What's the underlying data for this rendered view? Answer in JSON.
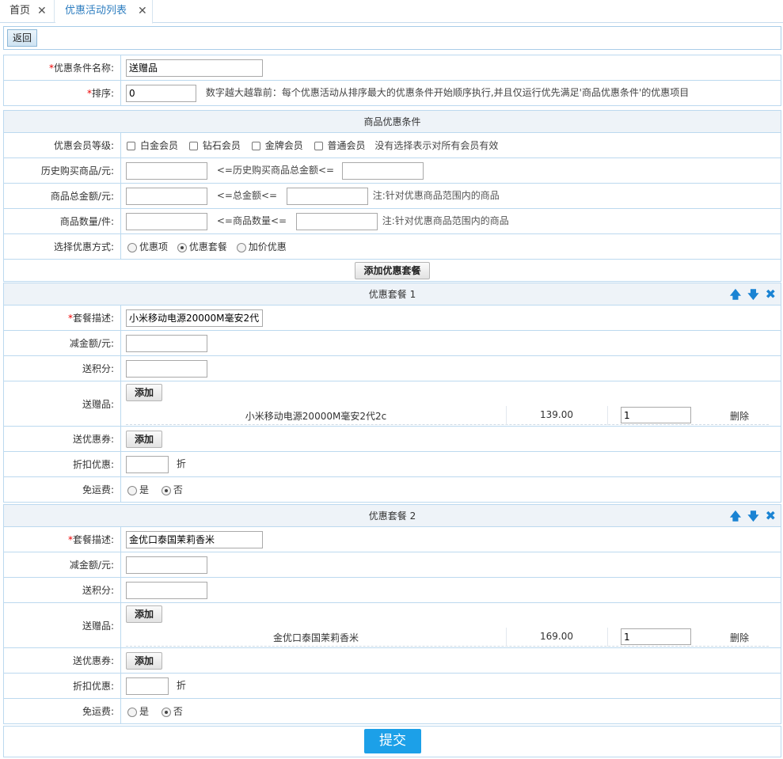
{
  "tabs": [
    {
      "label": "首页"
    },
    {
      "label": "优惠活动列表"
    }
  ],
  "toolbar": {
    "back_label": "返回"
  },
  "base": {
    "name_label": "优惠条件名称:",
    "name_value": "送赠品",
    "sort_label": "排序:",
    "sort_value": "0",
    "sort_hint": "数字越大越靠前：每个优惠活动从排序最大的优惠条件开始顺序执行,并且仅运行优先满足'商品优惠条件'的优惠项目"
  },
  "goods_condition": {
    "title": "商品优惠条件",
    "member_label": "优惠会员等级:",
    "members": [
      "白金会员",
      "钻石会员",
      "金牌会员",
      "普通会员"
    ],
    "member_hint": "没有选择表示对所有会员有效",
    "history_label": "历史购买商品/元:",
    "history_mid": "<=历史购买商品总金额<=",
    "total_label": "商品总金额/元:",
    "total_mid": "<=总金额<=",
    "total_hint": "注:针对优惠商品范围内的商品",
    "qty_label": "商品数量/件:",
    "qty_mid": "<=商品数量<=",
    "qty_hint": "注:针对优惠商品范围内的商品",
    "mode_label": "选择优惠方式:",
    "modes": [
      "优惠项",
      "优惠套餐",
      "加价优惠"
    ],
    "mode_selected": "优惠套餐",
    "add_package_label": "添加优惠套餐"
  },
  "packages": [
    {
      "title": "优惠套餐 1",
      "desc_label": "套餐描述:",
      "desc_value": "小米移动电源20000M毫安2代",
      "reduce_label": "减金额/元:",
      "points_label": "送积分:",
      "gift_label": "送赠品:",
      "add_label": "添加",
      "gift": {
        "name": "小米移动电源20000M毫安2代2c",
        "price": "139.00",
        "qty": "1",
        "delete": "删除"
      },
      "coupon_label": "送优惠券:",
      "discount_label": "折扣优惠:",
      "discount_unit": "折",
      "freeship_label": "免运费:",
      "yes": "是",
      "no": "否"
    },
    {
      "title": "优惠套餐 2",
      "desc_label": "套餐描述:",
      "desc_value": "金优口泰国茉莉香米",
      "reduce_label": "减金额/元:",
      "points_label": "送积分:",
      "gift_label": "送赠品:",
      "add_label": "添加",
      "gift": {
        "name": "金优口泰国茉莉香米",
        "price": "169.00",
        "qty": "1",
        "delete": "删除"
      },
      "coupon_label": "送优惠券:",
      "discount_label": "折扣优惠:",
      "discount_unit": "折",
      "freeship_label": "免运费:",
      "yes": "是",
      "no": "否"
    }
  ],
  "icons": {
    "up": "arrow-up-icon",
    "down": "arrow-down-icon",
    "remove": "close-icon"
  },
  "submit_label": "提交"
}
